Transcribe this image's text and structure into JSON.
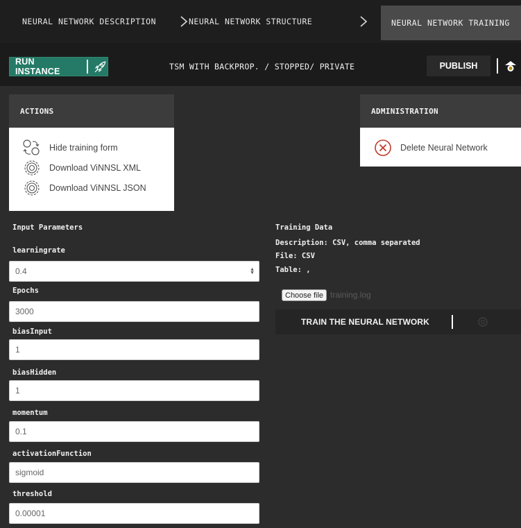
{
  "nav": {
    "steps": [
      "NEURAL NETWORK DESCRIPTION",
      "NEURAL NETWORK STRUCTURE",
      "NEURAL NETWORK TRAINING"
    ],
    "active_index": 2
  },
  "toolbar": {
    "run_label": "RUN INSTANCE",
    "status": "TSM WITH BACKPROP. / STOPPED/ PRIVATE",
    "publish_label": "PUBLISH"
  },
  "actions": {
    "title": "ACTIONS",
    "items": [
      {
        "label": "Hide training form",
        "icon": "toggle-form-icon"
      },
      {
        "label": "Download ViNNSL XML",
        "icon": "gear-icon"
      },
      {
        "label": "Download ViNNSL JSON",
        "icon": "gear-icon"
      }
    ]
  },
  "administration": {
    "title": "ADMINISTRATION",
    "delete_label": "Delete Neural Network"
  },
  "form": {
    "title": "Input Parameters",
    "fields": [
      {
        "label": "learningrate",
        "value": "0.4",
        "type": "select"
      },
      {
        "label": "Epochs",
        "value": "3000"
      },
      {
        "label": "biasInput",
        "value": "1"
      },
      {
        "label": "biasHidden",
        "value": "1"
      },
      {
        "label": "momentum",
        "value": "0.1"
      },
      {
        "label": "activationFunction",
        "value": "sigmoid"
      },
      {
        "label": "threshold",
        "value": "0.00001"
      }
    ]
  },
  "training": {
    "title": "Training Data",
    "description": "Description: CSV, comma separated",
    "file": "File: CSV",
    "table": "Table: ,",
    "choose_label": "Choose file",
    "file_name": "training.log",
    "train_label": "TRAIN THE NEURAL NETWORK"
  },
  "colors": {
    "accent": "#247a66",
    "background": "#2c2c2c",
    "delete": "#c0392b"
  }
}
